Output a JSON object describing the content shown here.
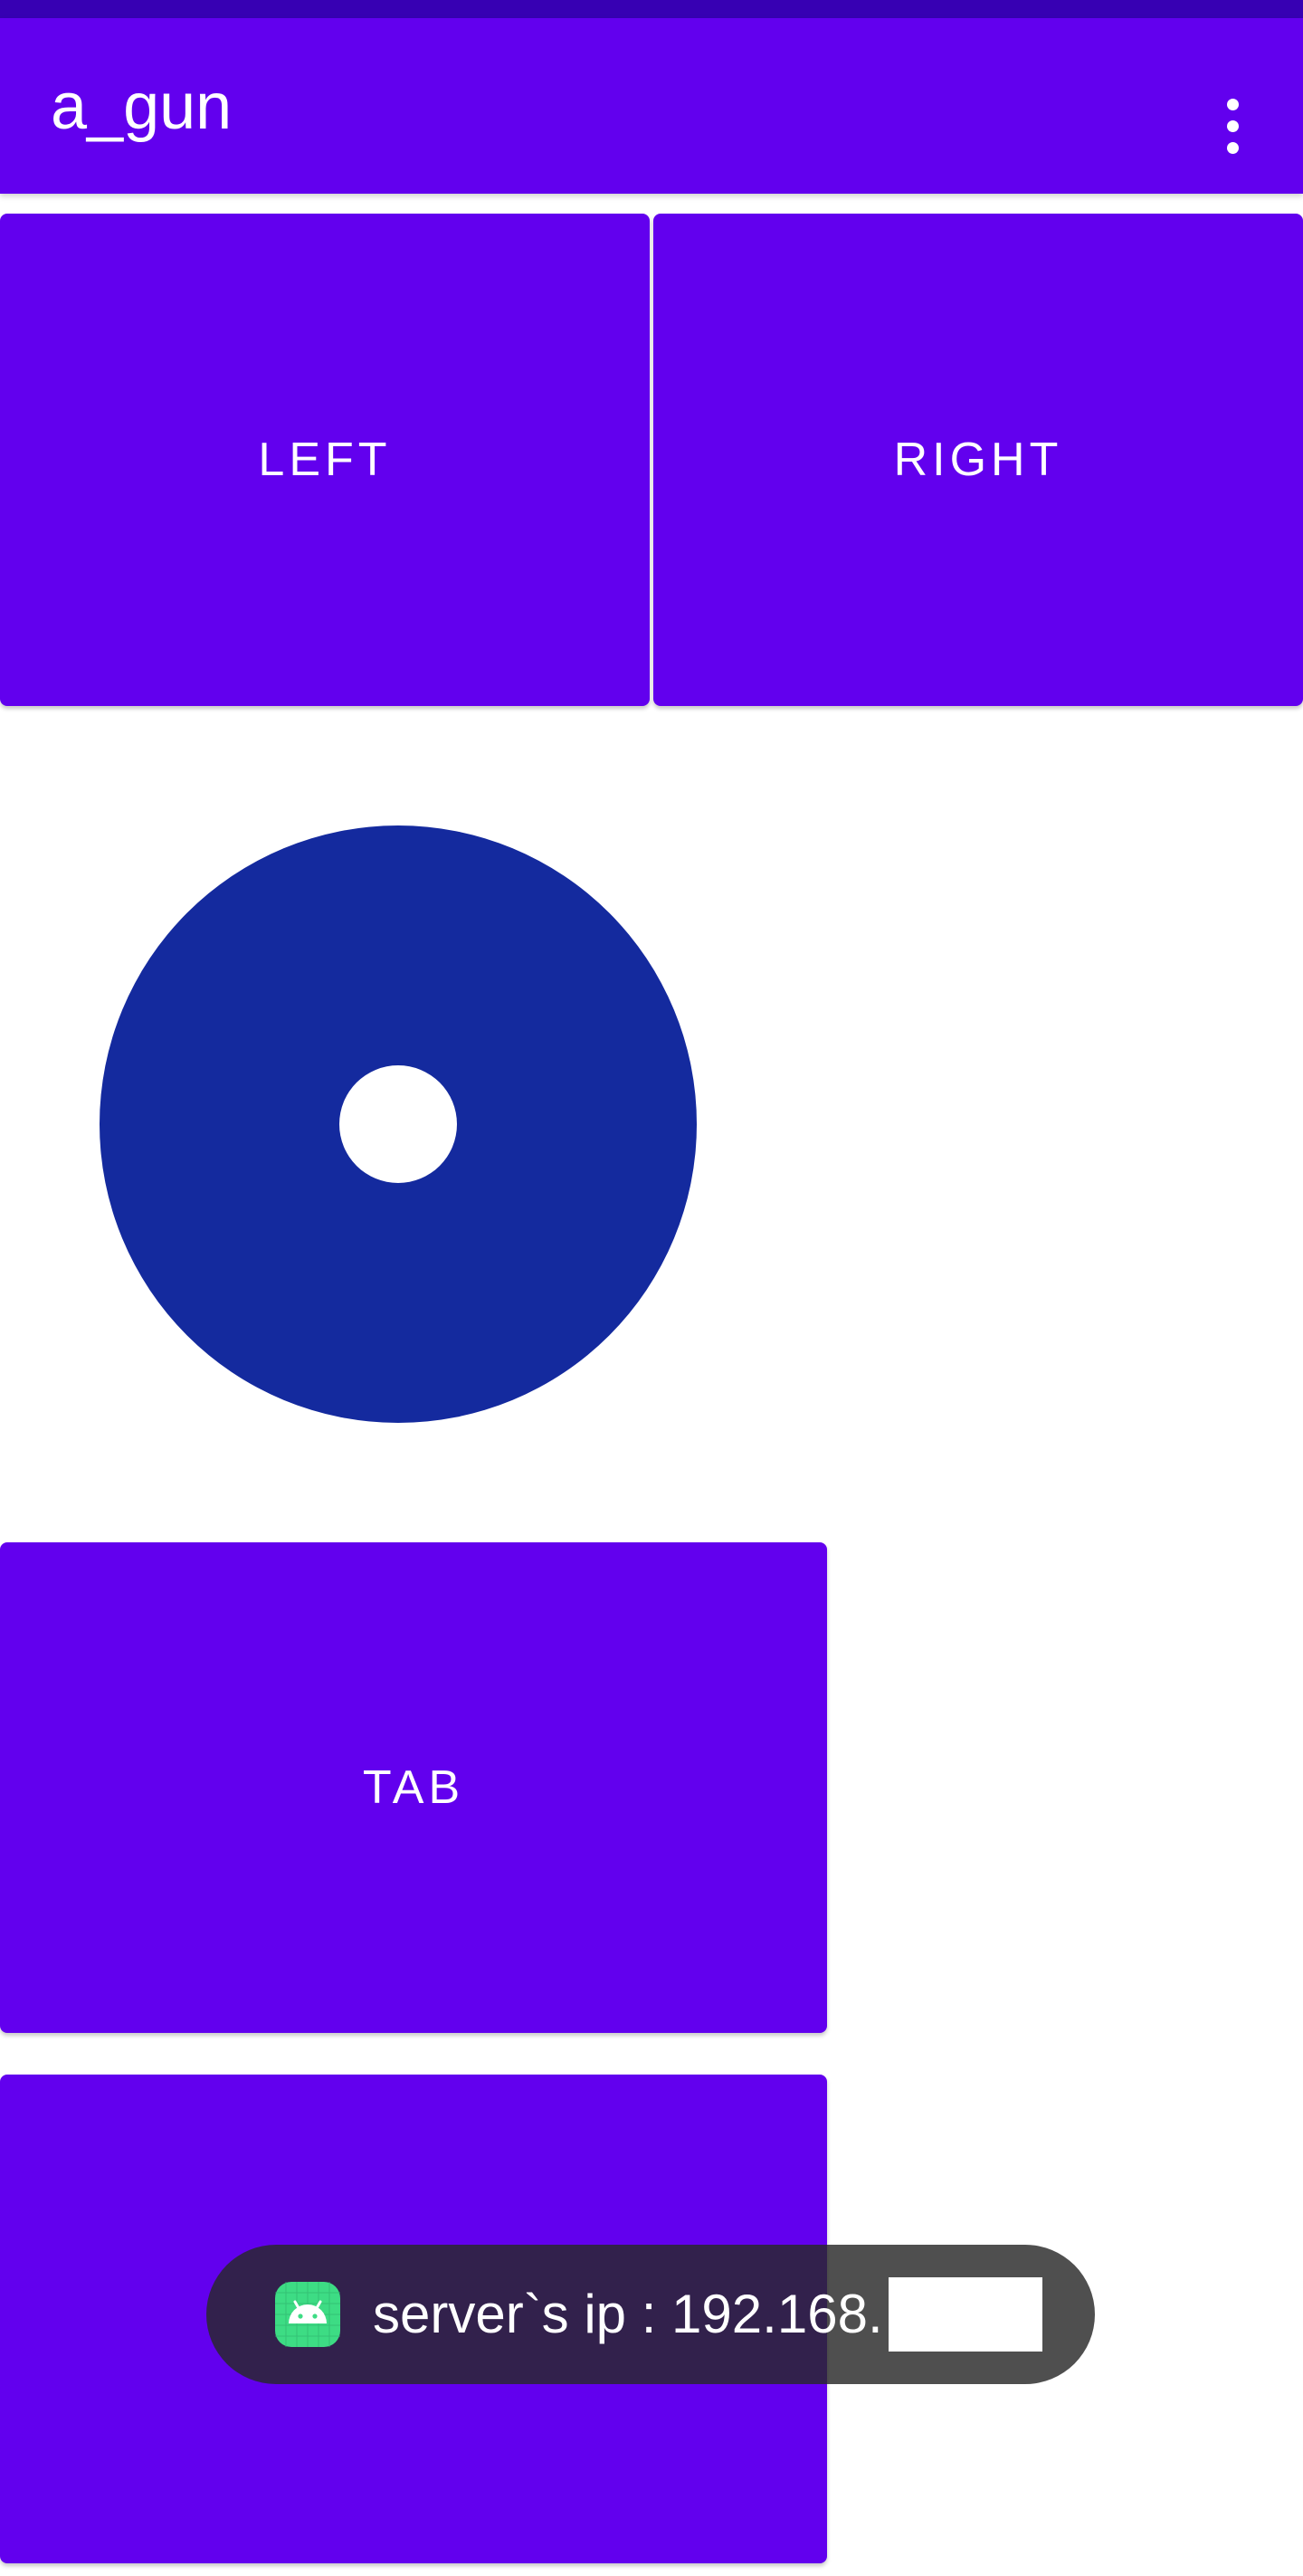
{
  "app": {
    "title": "a_gun",
    "colors": {
      "primary": "#6200ee",
      "primary_dark": "#3700b3",
      "joystick": "#142a9e",
      "toast_bg": "#282828"
    }
  },
  "toolbar": {
    "menu_icon": "overflow-vertical-icon"
  },
  "buttons": {
    "left_label": "LEFT",
    "right_label": "RIGHT",
    "tab_label": "TAB",
    "bottom_label": ""
  },
  "joystick": {
    "knob_position": "center"
  },
  "toast": {
    "icon": "android-app-icon",
    "message": "server`s ip : 192.168."
  }
}
